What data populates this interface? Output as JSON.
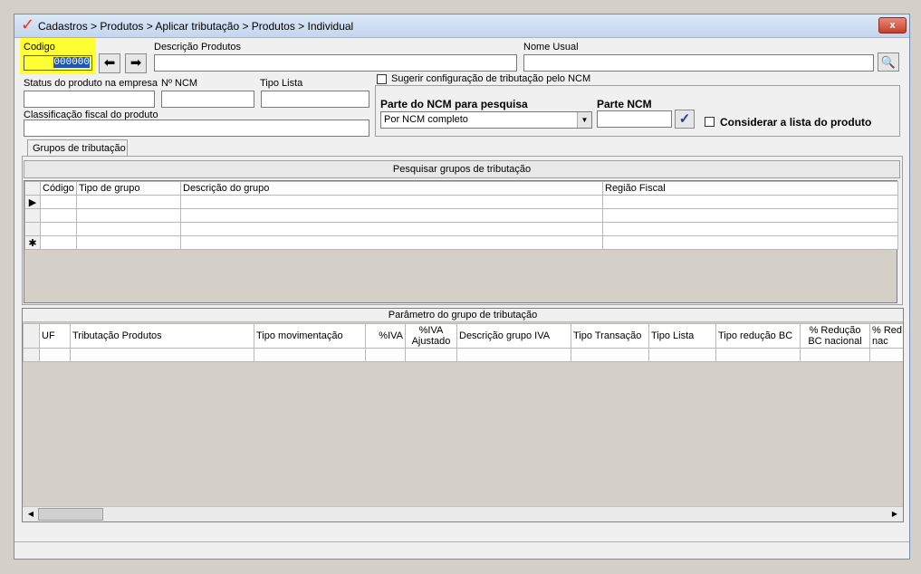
{
  "window": {
    "title": "Cadastros > Produtos > Aplicar tributação > Produtos > Individual",
    "close_label": "x"
  },
  "form": {
    "codigo_label": "Codigo",
    "codigo_value": "000000",
    "descricao_label": "Descrição  Produtos",
    "descricao_value": "",
    "nome_usual_label": "Nome Usual",
    "nome_usual_value": "",
    "status_label": "Status do produto na empresa",
    "ncm_label": "Nº NCM",
    "tipo_lista_label": "Tipo Lista",
    "classificacao_label": "Classificação fiscal do produto",
    "sugerir_label": "Sugerir configuração de tributação pelo NCM",
    "parte_ncm_pesquisa_label": "Parte do NCM para pesquisa",
    "parte_ncm_pesquisa_value": "Por NCM completo",
    "parte_ncm_label": "Parte NCM",
    "considerar_label": "Considerar a lista do produto"
  },
  "tabs": [
    {
      "label": "Grupos de tributação"
    }
  ],
  "grupos": {
    "search_button": "Pesquisar grupos de tributação",
    "columns": [
      "Código",
      "Tipo de grupo",
      "Descrição do grupo",
      "Região Fiscal"
    ],
    "row_markers": [
      "▶",
      "",
      "",
      "✱"
    ]
  },
  "parametro": {
    "title": "Parâmetro do grupo de tributação",
    "columns": [
      "UF",
      "Tributação Produtos",
      "Tipo movimentação",
      "%IVA",
      "%IVA Ajustado",
      "Descrição grupo IVA",
      "Tipo Transação",
      "Tipo Lista",
      "Tipo redução BC",
      "% Redução BC nacional",
      "% Red nac"
    ]
  },
  "icons": {
    "prev": "arrow-left-icon",
    "next": "arrow-right-icon",
    "search": "magnifier-icon",
    "confirm": "checkmark-icon",
    "app_logo": "checkmark-logo-icon"
  },
  "colors": {
    "highlight": "#ffff33",
    "selection": "#1d58b5",
    "title_bar": "#c4d6ee"
  }
}
